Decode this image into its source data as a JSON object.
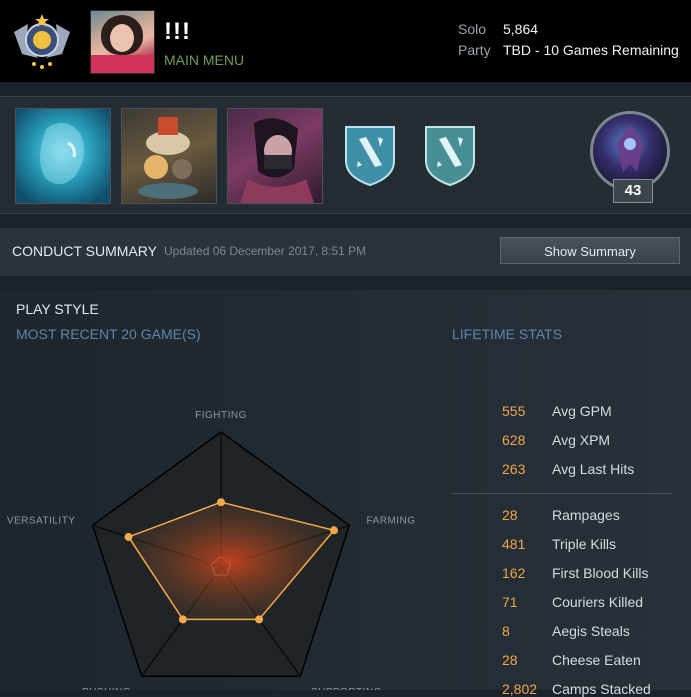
{
  "header": {
    "player_name": "!!!",
    "main_menu_label": "MAIN MENU",
    "solo_label": "Solo",
    "solo_value": "5,864",
    "party_label": "Party",
    "party_value": "TBD - 10 Games Remaining"
  },
  "heroes": {
    "level": "43",
    "featured": [
      "Morphling",
      "Techies",
      "Templar Assassin"
    ]
  },
  "conduct": {
    "title": "CONDUCT SUMMARY",
    "updated": "Updated 06 December 2017, 8:51 PM",
    "button": "Show Summary"
  },
  "playstyle": {
    "title": "PLAY STYLE",
    "recent": "MOST RECENT 20 GAME(S)",
    "lifetime": "LIFETIME STATS",
    "axes": [
      "FIGHTING",
      "FARMING",
      "SUPPORTING",
      "PUSHING",
      "VERSATILITY"
    ],
    "values": [
      0.48,
      0.88,
      0.48,
      0.48,
      0.72
    ]
  },
  "stats": [
    {
      "value": "555",
      "label": "Avg GPM"
    },
    {
      "value": "628",
      "label": "Avg XPM"
    },
    {
      "value": "263",
      "label": "Avg Last Hits"
    },
    {
      "value": "28",
      "label": "Rampages"
    },
    {
      "value": "481",
      "label": "Triple Kills"
    },
    {
      "value": "162",
      "label": "First Blood Kills"
    },
    {
      "value": "71",
      "label": "Couriers Killed"
    },
    {
      "value": "8",
      "label": "Aegis Steals"
    },
    {
      "value": "28",
      "label": "Cheese Eaten"
    },
    {
      "value": "2,802",
      "label": "Camps Stacked"
    }
  ],
  "colors": {
    "accent_orange": "#f0a64a",
    "main_menu_green": "#6f9e5a",
    "section_blue": "#5d87a8"
  }
}
